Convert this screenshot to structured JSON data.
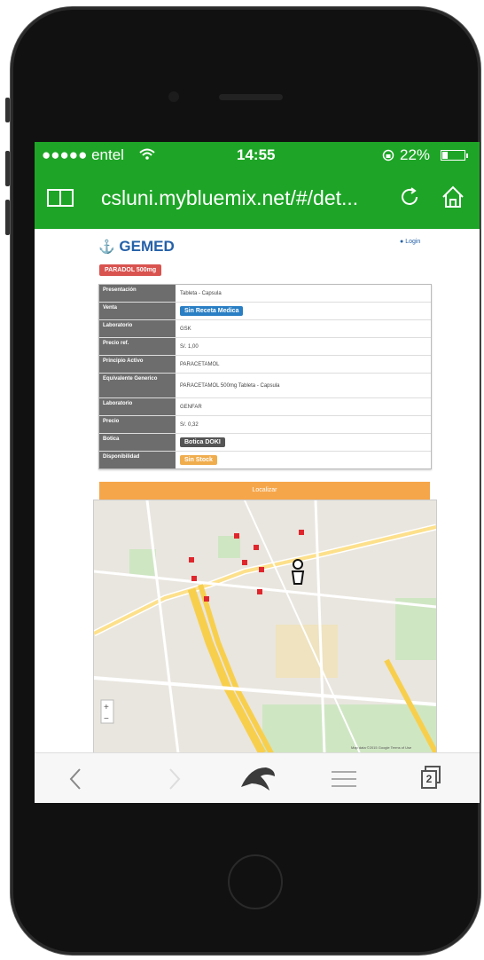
{
  "status": {
    "carrier": "●●●●● entel",
    "time": "14:55",
    "battery": "22%"
  },
  "browser": {
    "url": "csluni.mybluemix.net/#/det..."
  },
  "site": {
    "logo": "GEMED",
    "login": "Login"
  },
  "drug": {
    "name": "PARADOL 500mg"
  },
  "details": [
    {
      "label": "Presentación",
      "value": "Tableta - Capsula"
    },
    {
      "label": "Venta",
      "badge": "Sin Receta Medica",
      "badge_color": "#2a7fc4"
    },
    {
      "label": "Laboratorio",
      "value": "GSK"
    },
    {
      "label": "Precio ref.",
      "value": "S/. 1,00"
    },
    {
      "label": "Principio Activo",
      "value": "PARACETAMOL"
    },
    {
      "label": "Equivalente Generico",
      "value": "PARACETAMOL 500mg Tableta - Capsula"
    },
    {
      "label": "Laboratorio",
      "value": "GENFAR"
    },
    {
      "label": "Precio",
      "value": "S/. 0,32"
    },
    {
      "label": "Botica",
      "badge": "Botica DOKI",
      "badge_color": "#555555"
    },
    {
      "label": "Disponibilidad",
      "badge": "Sin Stock",
      "badge_color": "#f0ad4e"
    }
  ],
  "actions": {
    "wide_button": "Localizar"
  },
  "map": {
    "pins": 9,
    "zoom_in": "+",
    "zoom_out": "−",
    "attribution": "Map data ©2015 Google   Terms of Use"
  },
  "toolbar": {
    "tabs_count": "2"
  },
  "colors": {
    "green": "#1ea527",
    "orange": "#f6a64a",
    "red": "#d9534f",
    "blue": "#2561a8"
  }
}
